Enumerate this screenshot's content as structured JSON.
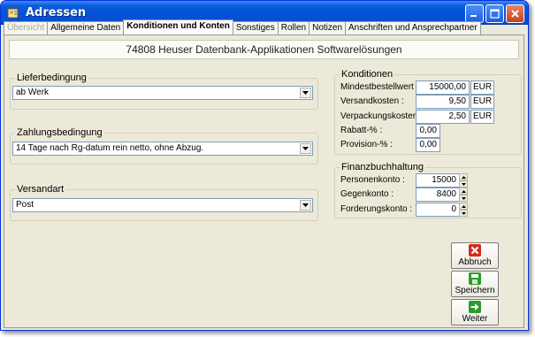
{
  "window": {
    "title": "Adressen",
    "controls": [
      "minimize-icon",
      "maximize-icon",
      "close-icon"
    ]
  },
  "tabs": [
    {
      "label": "Übersicht",
      "state": "disabled"
    },
    {
      "label": "Allgemeine Daten",
      "state": "normal"
    },
    {
      "label": "Konditionen und Konten",
      "state": "active"
    },
    {
      "label": "Sonstiges",
      "state": "normal"
    },
    {
      "label": "Rollen",
      "state": "normal"
    },
    {
      "label": "Notizen",
      "state": "normal"
    },
    {
      "label": "Anschriften und Ansprechpartner",
      "state": "normal"
    }
  ],
  "company_name": "74808 Heuser Datenbank-Applikationen Softwarelösungen",
  "lieferbedingung": {
    "legend": "Lieferbedingung",
    "value": "ab Werk"
  },
  "zahlungsbedingung": {
    "legend": "Zahlungsbedingung",
    "value": "14 Tage nach Rg-datum rein netto, ohne Abzug."
  },
  "versandart": {
    "legend": "Versandart",
    "value": "Post"
  },
  "konditionen": {
    "legend": "Konditionen",
    "mindestbestellwert": {
      "label": "Mindestbestellwert :",
      "value": "15000,00",
      "unit": "EUR"
    },
    "versandkosten": {
      "label": "Versandkosten :",
      "value": "9,50",
      "unit": "EUR"
    },
    "verpackungskosten": {
      "label": "Verpackungskosten :",
      "value": "2,50",
      "unit": "EUR"
    },
    "rabatt": {
      "label": "Rabatt-% :",
      "value": "0,00"
    },
    "provision": {
      "label": "Provision-% :",
      "value": "0,00"
    }
  },
  "finanzbuchhaltung": {
    "legend": "Finanzbuchhaltung",
    "personenkonto": {
      "label": "Personenkonto :",
      "value": "15000"
    },
    "gegenkonto": {
      "label": "Gegenkonto :",
      "value": "8400"
    },
    "forderungskonto": {
      "label": "Forderungskonto :",
      "value": "0"
    }
  },
  "buttons": {
    "abbruch": {
      "label": "Abbruch",
      "icon": "cancel-x-icon",
      "color": "#d42a1e"
    },
    "speichern": {
      "label": "Speichern",
      "icon": "save-icon",
      "color": "#2f9a2c"
    },
    "weiter": {
      "label": "Weiter",
      "icon": "arrow-right-icon",
      "color": "#2f9a2c"
    }
  },
  "colors": {
    "titlebar": "#0451d8",
    "panel": "#ece9d8",
    "input_border": "#7f9db9"
  }
}
